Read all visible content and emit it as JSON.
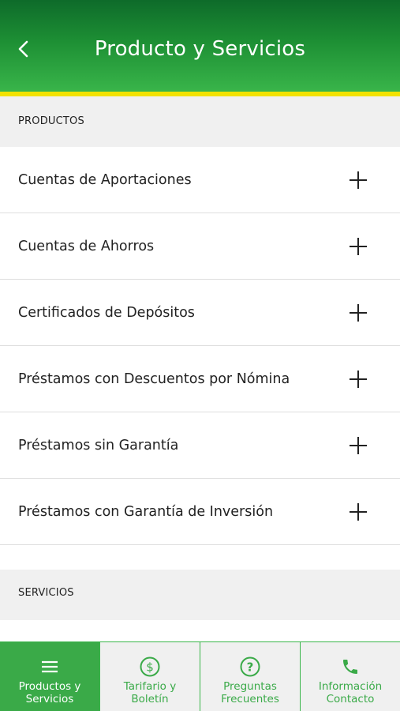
{
  "header": {
    "title": "Producto y Servicios"
  },
  "sections": {
    "products_label": "PRODUCTOS",
    "services_label": "SERVICIOS"
  },
  "products": [
    {
      "label": "Cuentas de Aportaciones"
    },
    {
      "label": "Cuentas de Ahorros"
    },
    {
      "label": "Certificados de Depósitos"
    },
    {
      "label": "Préstamos con Descuentos por Nómina"
    },
    {
      "label": "Préstamos sin Garantía"
    },
    {
      "label": "Préstamos con Garantía de Inversión"
    }
  ],
  "tabs": [
    {
      "label_line1": "Productos y",
      "label_line2": "Servicios",
      "icon": "menu-icon",
      "active": true
    },
    {
      "label_line1": "Tarifario y",
      "label_line2": "Boletín",
      "icon": "dollar-icon",
      "active": false
    },
    {
      "label_line1": "Preguntas",
      "label_line2": "Frecuentes",
      "icon": "question-icon",
      "active": false
    },
    {
      "label_line1": "Información",
      "label_line2": "Contacto",
      "icon": "phone-icon",
      "active": false
    }
  ],
  "colors": {
    "brand_green": "#3aaa48",
    "header_dark": "#0e6b2a",
    "accent_yellow": "#f2e200"
  }
}
